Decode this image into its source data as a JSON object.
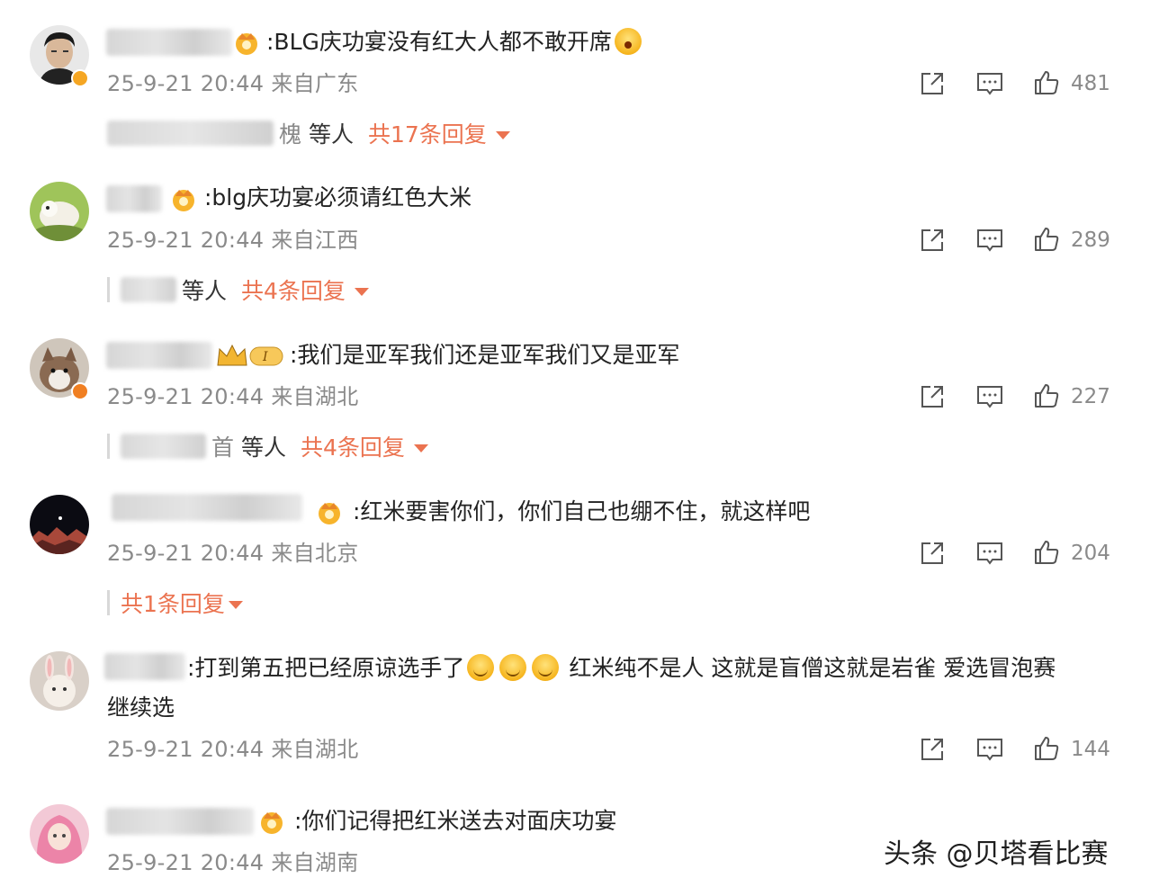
{
  "comments": [
    {
      "text": ":BLG庆功宴没有红大人都不敢开席",
      "emoji_after": "surprised-emoji",
      "time": "25-9-21 20:44",
      "location": "来自广东",
      "likes": "481",
      "reply_who": "等人",
      "reply_who_prefix": "槐",
      "reply_total": "共17条回复",
      "verified": true
    },
    {
      "text": ":blg庆功宴必须请红色大米",
      "time": "25-9-21 20:44",
      "location": "来自江西",
      "likes": "289",
      "reply_who": "等人",
      "reply_total": "共4条回复",
      "verified": false
    },
    {
      "badge_text": "I",
      "text": ":我们是亚军我们还是亚军我们又是亚军",
      "time": "25-9-21 20:44",
      "location": "来自湖北",
      "likes": "227",
      "reply_who": "等人",
      "reply_who_prefix": "首",
      "reply_total": "共4条回复",
      "verified": true
    },
    {
      "text": ":红米要害你们，你们自己也绷不住，就这样吧",
      "time": "25-9-21 20:44",
      "location": "来自北京",
      "likes": "204",
      "reply_total": "共1条回复",
      "verified": false
    },
    {
      "text_part1": ":打到第五把已经原谅选手了",
      "text_part2": "红米纯不是人 这就是盲僧这就是岩雀 爱选冒泡赛",
      "text_line2": "继续选",
      "time": "25-9-21 20:44",
      "location": "来自湖北",
      "likes": "144",
      "verified": false
    },
    {
      "text": ":你们记得把红米送去对面庆功宴",
      "time": "25-9-21 20:44",
      "location": "来自湖南",
      "verified": false
    }
  ],
  "colors": {
    "accent": "#eb7350",
    "meta": "#8a8a8a",
    "verify": "#f5a623"
  },
  "icons": [
    "share-icon",
    "comment-icon",
    "like-icon",
    "caret-down-icon",
    "crown-badge-icon",
    "verified-icon"
  ],
  "watermark": "头条 @贝塔看比赛"
}
